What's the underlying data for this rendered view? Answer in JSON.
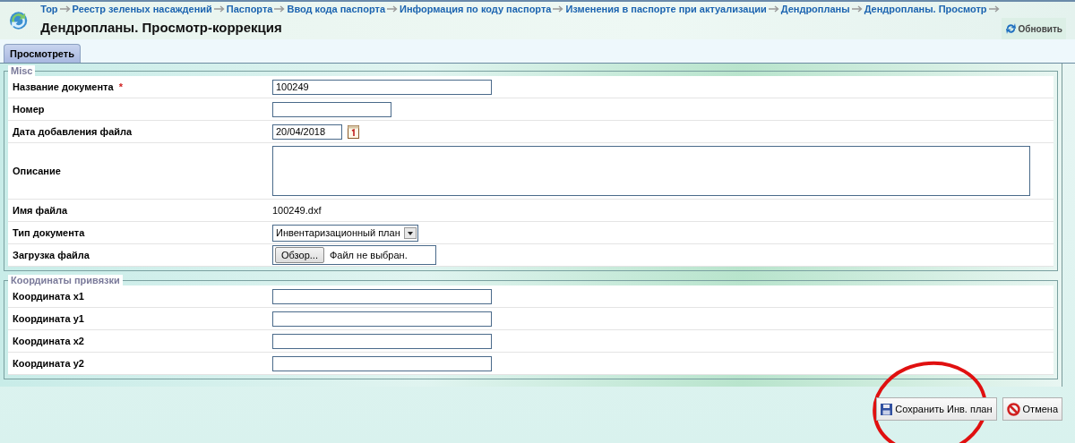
{
  "breadcrumbs": [
    "Top",
    "Реестр зеленых насаждений",
    "Паспорта",
    "Ввод кода паспорта",
    "Информация по коду паспорта",
    "Изменения в паспорте при актуализации",
    "Дендропланы",
    "Дендропланы. Просмотр"
  ],
  "page_title": "Дендропланы. Просмотр-коррекция",
  "refresh_button": "Обновить",
  "tabs": [
    {
      "label": "Просмотреть",
      "selected": true
    }
  ],
  "sections": [
    {
      "legend": "Misc",
      "fields": [
        {
          "kind": "text",
          "label": "Название документа",
          "required_mark": "*",
          "value": "100249"
        },
        {
          "kind": "short_text",
          "label": "Номер"
        },
        {
          "kind": "date",
          "label": "Дата добавления файла",
          "value": "20/04/2018"
        },
        {
          "kind": "textarea",
          "label": "Описание"
        },
        {
          "kind": "static",
          "label": "Имя файла",
          "value": "100249.dxf"
        },
        {
          "kind": "select",
          "label": "Тип документа",
          "value": "Инвентаризационный план"
        },
        {
          "kind": "file",
          "label": "Загрузка файла",
          "button": "Обзор...",
          "value": "Файл не выбран."
        }
      ]
    },
    {
      "legend": "Координаты привязки",
      "fields": [
        {
          "kind": "text",
          "label": "Координата x1"
        },
        {
          "kind": "text",
          "label": "Координата y1"
        },
        {
          "kind": "text",
          "label": "Координата x2"
        },
        {
          "kind": "text",
          "label": "Координата y2"
        }
      ]
    }
  ],
  "actions": [
    {
      "kind": "save",
      "label": "Сохранить Инв. план",
      "circled": true
    },
    {
      "kind": "cancel",
      "label": "Отмена",
      "circled": false
    }
  ]
}
